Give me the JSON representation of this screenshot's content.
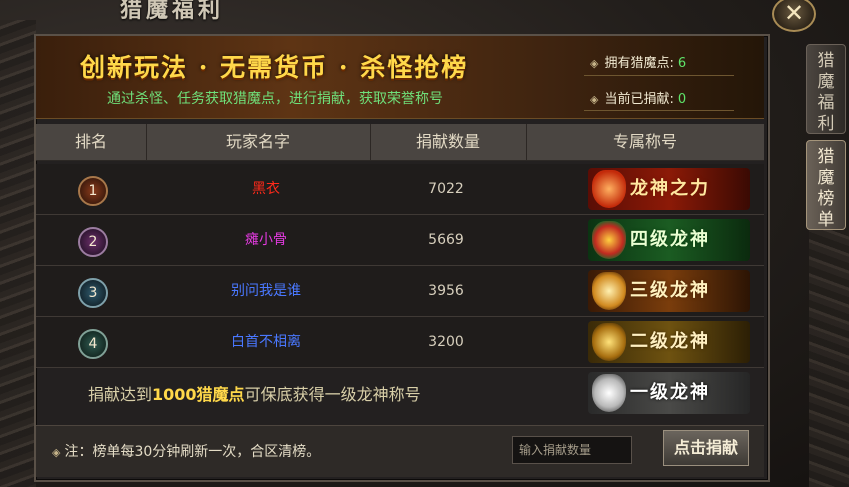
{
  "window": {
    "title": "猎魔福利",
    "close_glyph": "✕"
  },
  "banner": {
    "headline": "创新玩法 · 无需货币 · 杀怪抢榜",
    "subtitle": "通过杀怪、任务获取猎魔点，进行捐献，获取荣誉称号",
    "stats": [
      {
        "label": "拥有猎魔点:",
        "value": "6"
      },
      {
        "label": "当前已捐献:",
        "value": "0"
      }
    ]
  },
  "table": {
    "headers": [
      "排名",
      "玩家名字",
      "捐献数量",
      "专属称号"
    ],
    "rows": [
      {
        "rank": "1",
        "name": "黑衣",
        "name_color": "#ff2a1a",
        "count": "7022",
        "title": "龙神之力"
      },
      {
        "rank": "2",
        "name": "瘫小骨",
        "name_color": "#e23adf",
        "count": "5669",
        "title": "四级龙神"
      },
      {
        "rank": "3",
        "name": "别问我是谁",
        "name_color": "#4a78ff",
        "count": "3956",
        "title": "三级龙神"
      },
      {
        "rank": "4",
        "name": "白首不相离",
        "name_color": "#4a78ff",
        "count": "3200",
        "title": "二级龙神"
      }
    ]
  },
  "guarantee": {
    "prefix": "捐献达到",
    "highlight": "1000猎魔点",
    "suffix": "可保底获得一级龙神称号",
    "badge_title": "一级龙神"
  },
  "footer": {
    "note": "注：榜单每30分钟刷新一次，合区清榜。",
    "input_placeholder": "输入捐献数量",
    "donate_label": "点击捐献"
  },
  "side_tabs": [
    {
      "label": "猎魔福利",
      "active": false
    },
    {
      "label": "猎魔榜单",
      "active": true
    }
  ],
  "icons": {
    "diamond_bullet": "◈"
  }
}
